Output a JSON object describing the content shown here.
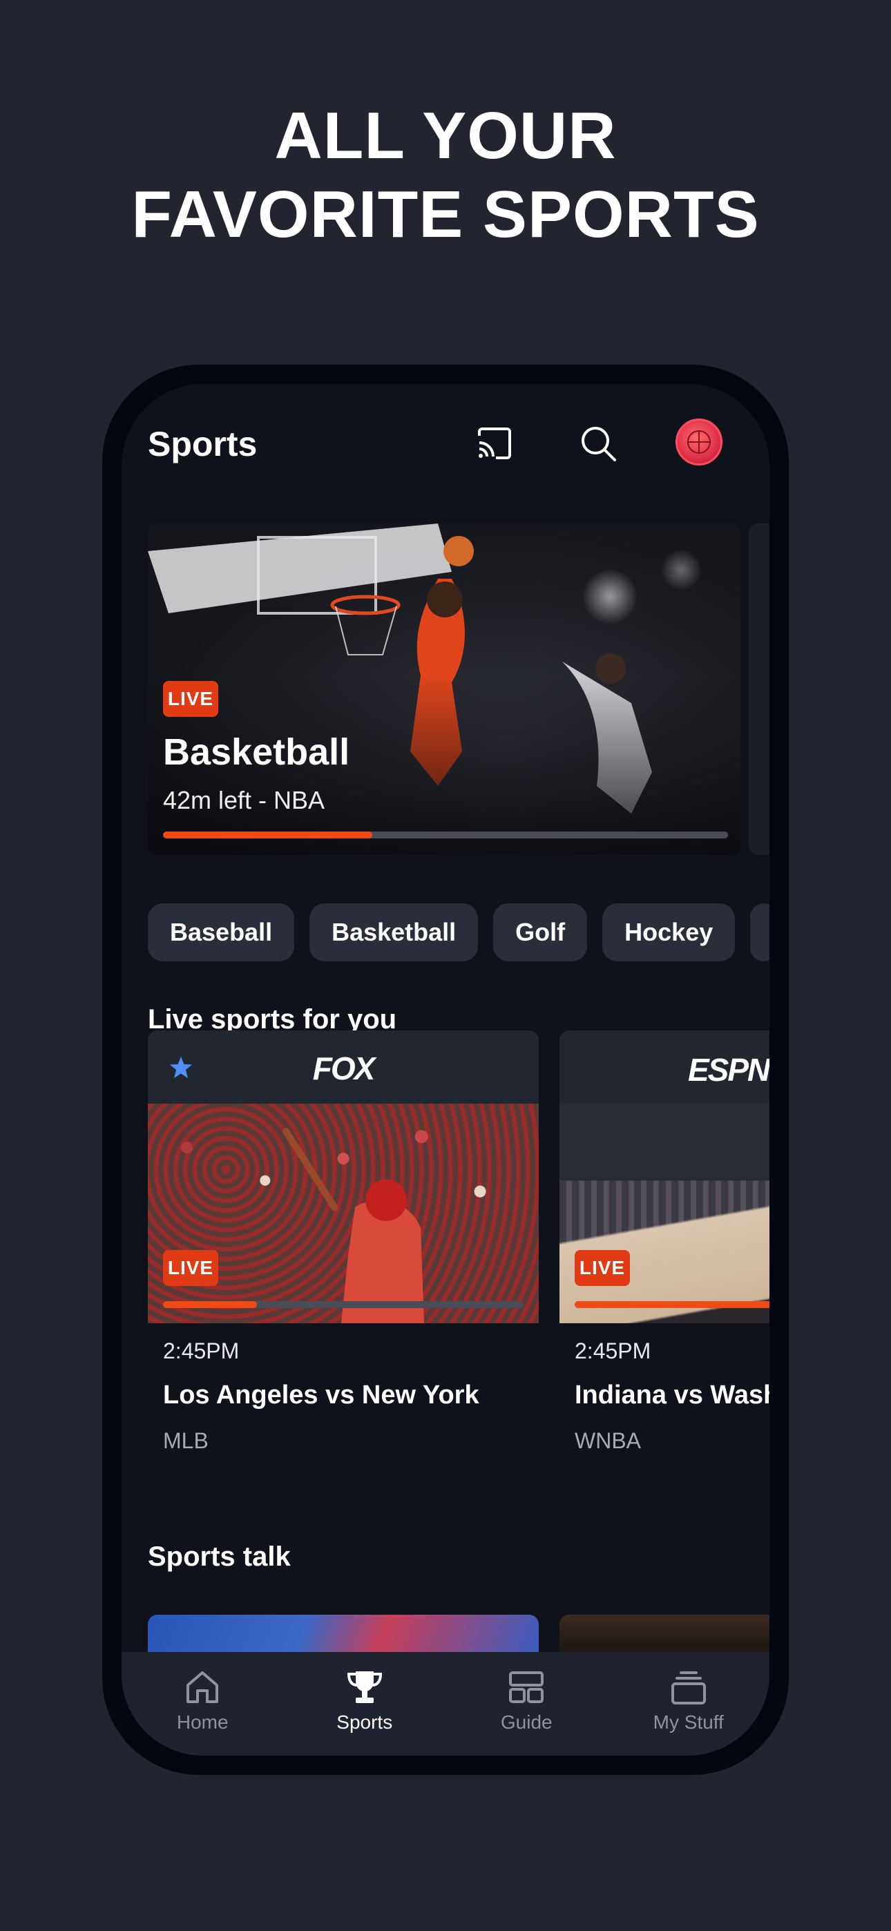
{
  "headline": {
    "line1": "ALL YOUR",
    "line2": "FAVORITE SPORTS"
  },
  "header": {
    "title": "Sports",
    "icons": [
      "cast-icon",
      "search-icon",
      "profile-avatar"
    ]
  },
  "hero": {
    "badge": "LIVE",
    "title": "Basketball",
    "subtitle": "42m left - NBA",
    "progress": 0.37
  },
  "chips": [
    "Baseball",
    "Basketball",
    "Golf",
    "Hockey"
  ],
  "live_section": {
    "title": "Live sports for you",
    "cards": [
      {
        "network": "FOX",
        "favorite": true,
        "badge": "LIVE",
        "progress": 0.26,
        "time": "2:45PM",
        "title": "Los Angeles vs New York",
        "league": "MLB"
      },
      {
        "network": "ESPN",
        "favorite": false,
        "badge": "LIVE",
        "progress": 0.55,
        "time": "2:45PM",
        "title": "Indiana vs Wash",
        "league": "WNBA"
      }
    ]
  },
  "talk_section": {
    "title": "Sports talk"
  },
  "nav": {
    "items": [
      {
        "label": "Home",
        "icon": "home-icon",
        "active": false
      },
      {
        "label": "Sports",
        "icon": "trophy-icon",
        "active": true
      },
      {
        "label": "Guide",
        "icon": "guide-icon",
        "active": false
      },
      {
        "label": "My Stuff",
        "icon": "stack-icon",
        "active": false
      }
    ]
  },
  "colors": {
    "accent": "#e03b15",
    "background": "#222530",
    "screen": "#0f121b",
    "chip": "#2a2e3a"
  }
}
